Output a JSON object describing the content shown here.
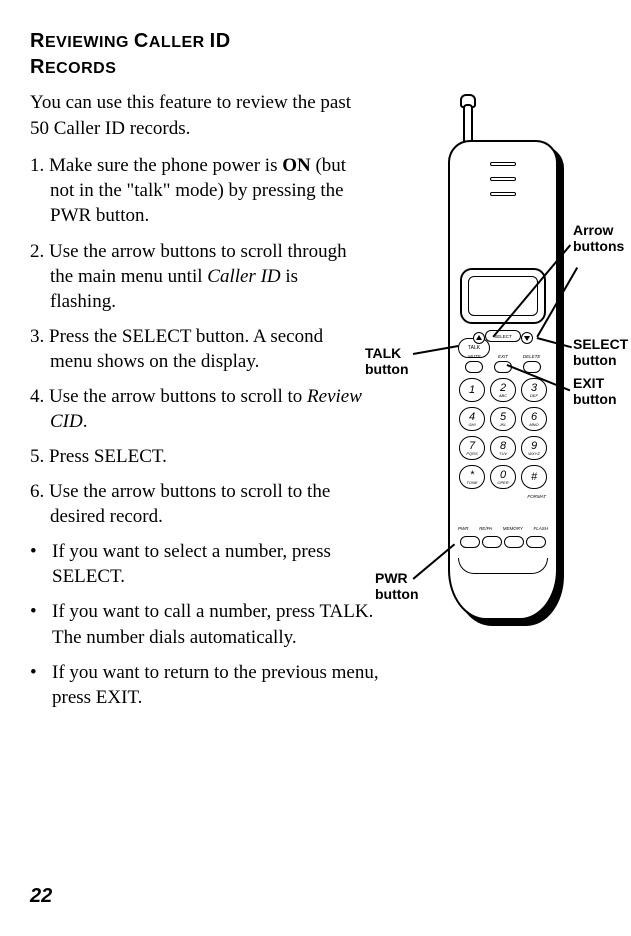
{
  "heading_line1_caps": "R",
  "heading_line1_rest": "EVIEWING ",
  "heading_line1_caps2": "C",
  "heading_line1_rest2": "ALLER ",
  "heading_line1_caps3": "ID",
  "heading_line2_caps": "R",
  "heading_line2_rest": "ECORDS",
  "intro": "You can use this feature to review the past 50 Caller ID records.",
  "steps": [
    {
      "num": "1.",
      "pre": "Make sure the phone power is ",
      "bold": "ON",
      "post": " (but not in the \"talk\" mode) by pressing the PWR button."
    },
    {
      "num": "2.",
      "pre": "Use the arrow buttons to scroll through the main menu until ",
      "em": "Caller ID",
      "post": " is flashing."
    },
    {
      "num": "3.",
      "text": "Press the SELECT button. A second menu shows on the display."
    },
    {
      "num": "4.",
      "pre": "Use the arrow buttons to scroll to ",
      "em": "Review CID",
      "post": "."
    },
    {
      "num": "5.",
      "text": "Press SELECT."
    },
    {
      "num": "6.",
      "text": "Use the arrow buttons to scroll to the desired record."
    }
  ],
  "bullets": [
    "If you want to select a number, press SELECT.",
    "If you want to call a number, press TALK. The number dials automatically.",
    "If you want to return to the previous menu, press EXIT."
  ],
  "page_number": "22",
  "callouts": {
    "arrow": "Arrow\nbuttons",
    "select": "SELECT\nbutton",
    "exit": "EXIT\nbutton",
    "talk": "TALK\nbutton",
    "pwr": "PWR\nbutton"
  },
  "phone": {
    "talk_label": "TALK",
    "select_label": "SELECT",
    "mid_labels": [
      "MUTE",
      "EXIT",
      "DELETE"
    ],
    "keys": [
      {
        "n": "1",
        "l": ""
      },
      {
        "n": "2",
        "l": "ABC"
      },
      {
        "n": "3",
        "l": "DEF"
      },
      {
        "n": "4",
        "l": "GHI"
      },
      {
        "n": "5",
        "l": "JKL"
      },
      {
        "n": "6",
        "l": "MNO"
      },
      {
        "n": "7",
        "l": "PQRS"
      },
      {
        "n": "8",
        "l": "TUV"
      },
      {
        "n": "9",
        "l": "WXYZ"
      },
      {
        "n": "*",
        "l": "TONE"
      },
      {
        "n": "0",
        "l": "OPER"
      },
      {
        "n": "#",
        "l": ""
      }
    ],
    "format_label": "FORMAT",
    "bottom_labels": [
      "PWR",
      "RE/PA",
      "MEMORY",
      "FLASH"
    ]
  }
}
